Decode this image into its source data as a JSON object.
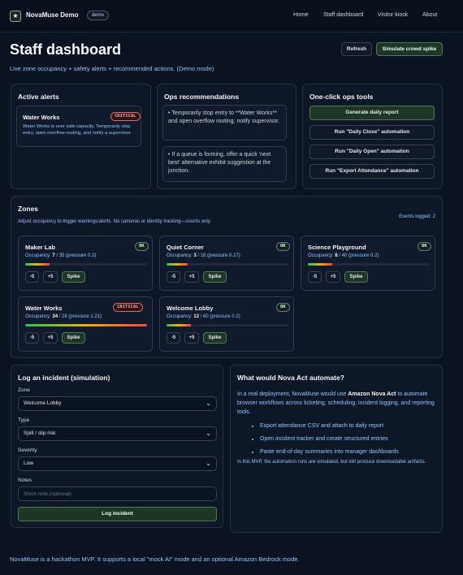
{
  "app": {
    "brand": "NovaMuse Demo",
    "demo_pill": "demo",
    "logo_icon": "★",
    "nav": [
      "Home",
      "Staff dashboard",
      "Visitor kiosk",
      "About"
    ]
  },
  "header": {
    "title": "Staff dashboard",
    "subtitle": "Live zone occupancy + safety alerts + recommended actions. (Demo mode)",
    "refresh_label": "Refresh",
    "simulate_label": "Simulate crowd spike"
  },
  "alerts": {
    "title": "Active alerts",
    "items": [
      {
        "zone": "Water Works",
        "badge": "CRITICAL",
        "text": "Water Works is over safe capacity. Temporarily stop entry, open overflow routing, and notify a supervisor."
      }
    ]
  },
  "ops": {
    "title": "Ops recommendations",
    "items": [
      "• Temporarily stop entry to **Water Works** and open overflow routing; notify supervisor.",
      "• If a queue is forming, offer a quick 'next best' alternative exhibit suggestion at the junction."
    ]
  },
  "tools": {
    "title": "One-click ops tools",
    "buttons": [
      "Generate daily report",
      "Run \"Daily Close\" automation",
      "Run \"Daily Open\" automation",
      "Run \"Export Attendance\" automation"
    ]
  },
  "zones": {
    "title": "Zones",
    "description": "Adjust occupancy to trigger warnings/alerts. No cameras or identity tracking—counts only.",
    "events_logged": "Events logged: 2",
    "occupancy_prefix": "Occupancy:",
    "minus_label": "-5",
    "plus_label": "+5",
    "spike_label": "Spike",
    "items": [
      {
        "name": "Maker Lab",
        "occ": "7",
        "cap": "/ 35 (pressure 0.2)",
        "status": "OK",
        "pressure": 0.2
      },
      {
        "name": "Quiet Corner",
        "occ": "3",
        "cap": "/ 18 (pressure 0.17)",
        "status": "OK",
        "pressure": 0.17
      },
      {
        "name": "Science Playground",
        "occ": "8",
        "cap": "/ 40 (pressure 0.2)",
        "status": "OK",
        "pressure": 0.2
      },
      {
        "name": "Water Works",
        "occ": "34",
        "cap": "/ 28 (pressure 1.21)",
        "status": "CRITICAL",
        "pressure": 1.0
      },
      {
        "name": "Welcome Lobby",
        "occ": "12",
        "cap": "/ 60 (pressure 0.2)",
        "status": "OK",
        "pressure": 0.2
      }
    ]
  },
  "incident": {
    "title": "Log an incident (simulation)",
    "zone_label": "Zone",
    "zone_value": "Welcome Lobby",
    "type_label": "Type",
    "type_value": "Spill / slip risk",
    "severity_label": "Severity",
    "severity_value": "Low",
    "notes_label": "Notes",
    "notes_placeholder": "Short note (optional)",
    "submit_label": "Log incident"
  },
  "nova": {
    "title": "What would Nova Act automate?",
    "intro_pre": "In a real deployment, NovaMuse would use ",
    "intro_bold": "Amazon Nova Act",
    "intro_post": " to automate browser workflows across ticketing, scheduling, incident logging, and reporting tools.",
    "bullets": [
      "Export attendance CSV and attach to daily report",
      "Open incident tracker and create structured entries",
      "Paste end-of-day summaries into manager dashboards"
    ],
    "note": "In this MVP, the automation runs are simulated, but still produce downloadable artifacts."
  },
  "footer": {
    "text": "NovaMuse is a hackathon MVP. It supports a local \"mock AI\" mode and an optional Amazon Bedrock mode."
  }
}
